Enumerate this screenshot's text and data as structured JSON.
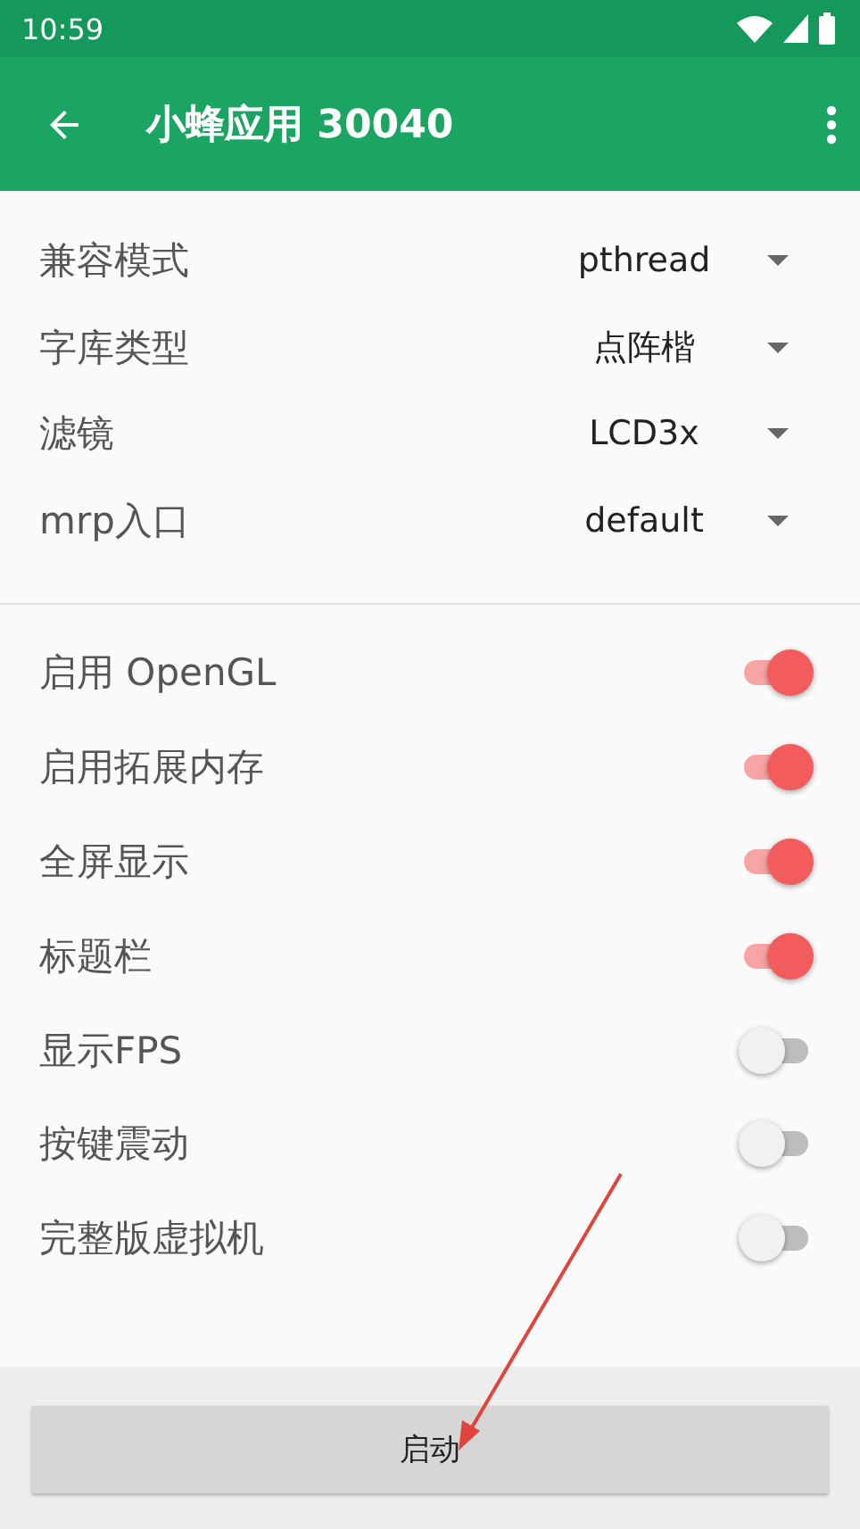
{
  "status_bar": {
    "time": "10:59"
  },
  "app_bar": {
    "title": "小蜂应用 30040"
  },
  "dropdowns": [
    {
      "label": "兼容模式",
      "value": "pthread"
    },
    {
      "label": "字库类型",
      "value": "点阵楷"
    },
    {
      "label": "滤镜",
      "value": "LCD3x"
    },
    {
      "label": "mrp入口",
      "value": "default"
    }
  ],
  "switches": [
    {
      "label": "启用 OpenGL",
      "on": true
    },
    {
      "label": "启用拓展内存",
      "on": true
    },
    {
      "label": "全屏显示",
      "on": true
    },
    {
      "label": "标题栏",
      "on": true
    },
    {
      "label": "显示FPS",
      "on": false
    },
    {
      "label": "按键震动",
      "on": false
    },
    {
      "label": "完整版虚拟机",
      "on": false
    }
  ],
  "start_button": {
    "label": "启动"
  }
}
